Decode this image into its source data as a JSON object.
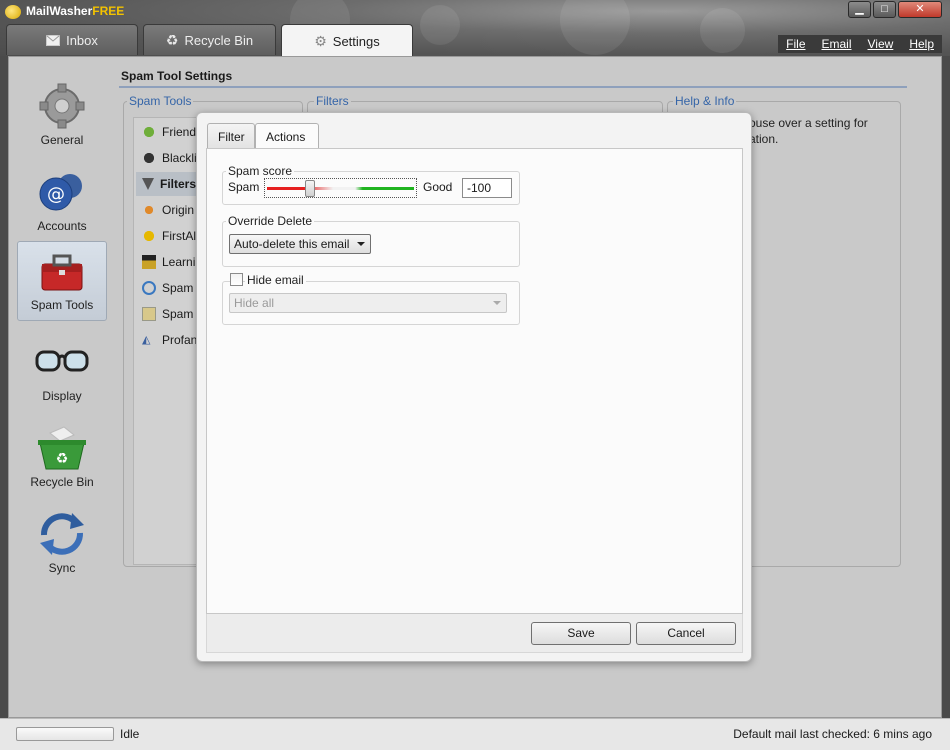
{
  "app": {
    "title_main": "MailWasher",
    "title_free": "FREE"
  },
  "window_controls": {
    "minimize": "▁",
    "maximize": "□",
    "close": "✕"
  },
  "tabs": [
    {
      "label": "Inbox",
      "icon": "envelope-icon"
    },
    {
      "label": "Recycle Bin",
      "icon": "recycle-icon"
    },
    {
      "label": "Settings",
      "icon": "gear-icon"
    }
  ],
  "menu": [
    "File",
    "Email",
    "View",
    "Help"
  ],
  "sidebar": {
    "items": [
      {
        "label": "General",
        "icon": "gear-icon"
      },
      {
        "label": "Accounts",
        "icon": "accounts-icon"
      },
      {
        "label": "Spam Tools",
        "icon": "toolbox-icon"
      },
      {
        "label": "Display",
        "icon": "glasses-icon"
      },
      {
        "label": "Recycle Bin",
        "icon": "recycle-bin-icon"
      },
      {
        "label": "Sync",
        "icon": "sync-icon"
      }
    ]
  },
  "settings": {
    "section_title": "Spam Tool Settings",
    "spam_tools_label": "Spam Tools",
    "filters_label": "Filters",
    "help_label": "Help & Info",
    "help_text_line1": "ouse over a setting for",
    "help_text_line2": "ation.",
    "tools": [
      {
        "label": "Friends",
        "icon": "friends-icon"
      },
      {
        "label": "Blacklis",
        "icon": "blacklist-icon"
      },
      {
        "label": "Filters",
        "icon": "filter-icon"
      },
      {
        "label": "Origin",
        "icon": "origin-icon"
      },
      {
        "label": "FirstAle",
        "icon": "firstalert-icon"
      },
      {
        "label": "Learnin",
        "icon": "learning-icon"
      },
      {
        "label": "Spam F",
        "icon": "spam-filter-icon"
      },
      {
        "label": "Spam F",
        "icon": "spam-report-icon"
      },
      {
        "label": "Profani",
        "icon": "profanity-icon"
      }
    ]
  },
  "dialog": {
    "tabs": [
      "Filter",
      "Actions"
    ],
    "spam_score": {
      "label": "Spam score",
      "left_label": "Spam",
      "right_label": "Good",
      "value": "-100",
      "slider_fraction": 0.27
    },
    "override_delete": {
      "label": "Override Delete",
      "selected": "Auto-delete this email"
    },
    "hide_email": {
      "label": "Hide email",
      "checked": false,
      "selected": "Hide all"
    },
    "buttons": {
      "save": "Save",
      "cancel": "Cancel"
    }
  },
  "status": {
    "text": "Idle",
    "right_text": "Default mail last checked: 6 mins ago"
  }
}
